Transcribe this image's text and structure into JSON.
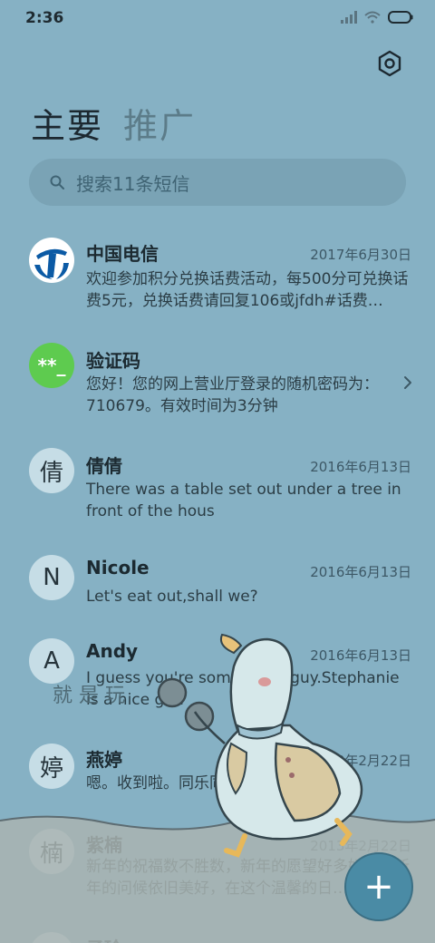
{
  "status": {
    "time": "2:36"
  },
  "tabs": [
    {
      "label": "主要"
    },
    {
      "label": "推广"
    }
  ],
  "search": {
    "placeholder": "搜索11条短信"
  },
  "messages": [
    {
      "sender": "中国电信",
      "date": "2017年6月30日",
      "preview": "欢迎参加积分兑换话费活动，每500分可兑换话费5元，兑换话费请回复106或jfdh#话费…"
    },
    {
      "sender": "验证码",
      "avatar_text": "**_",
      "preview": "您好！您的网上营业厅登录的随机密码为：710679。有效时间为3分钟"
    },
    {
      "sender": "倩倩",
      "avatar_text": "倩",
      "date": "2016年6月13日",
      "preview": "There was a table set out under a tree in front of the hous"
    },
    {
      "sender": "Nicole",
      "avatar_text": "N",
      "date": "2016年6月13日",
      "preview": "Let's eat out,shall we?"
    },
    {
      "sender": "Andy",
      "avatar_text": "A",
      "date": "2016年6月13日",
      "preview": "I guess you're some lucky guy.Stephanie is a nice girl."
    },
    {
      "sender": "燕婷",
      "avatar_text": "婷",
      "date": "2013年2月22日",
      "preview": "嗯。收到啦。同乐同乐。"
    },
    {
      "sender": "紫楠",
      "avatar_text": "楠",
      "date": "2013年2月22日",
      "preview": "新年的祝福数不胜数，新年的愿望好多好多，新年的问候依旧美好，在这个温馨的日…"
    },
    {
      "sender": "子玲",
      "avatar_text": ""
    }
  ],
  "doodle_text": "就 是 玩",
  "fab": {
    "symbol": "+"
  },
  "colors": {
    "background": "#86b1c4",
    "fab": "#4a8ba5",
    "verify_avatar": "#5ecb4f",
    "telecom_blue": "#0b5aa5"
  }
}
